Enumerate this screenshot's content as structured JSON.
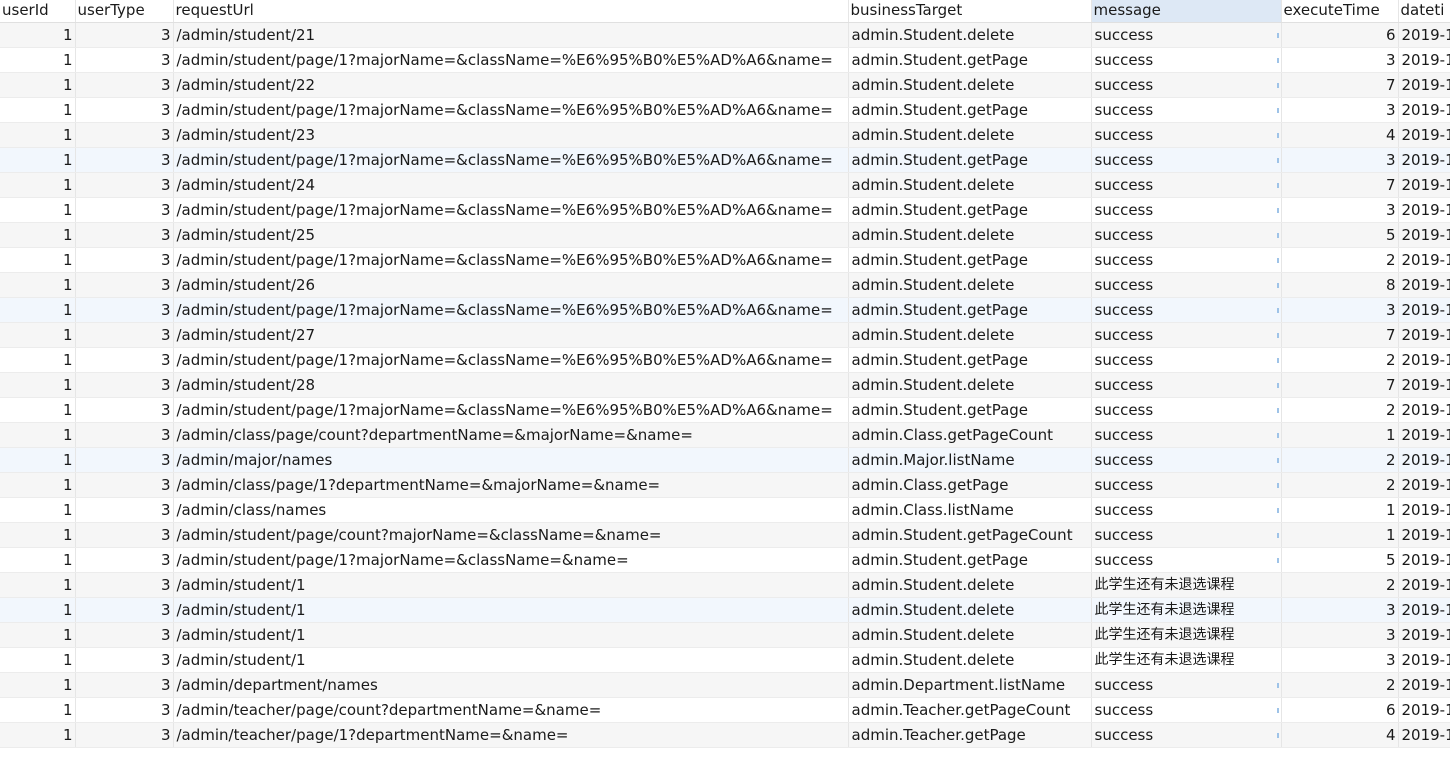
{
  "columns": [
    "userId",
    "userType",
    "requestUrl",
    "businessTarget",
    "message",
    "executeTime",
    "dateti"
  ],
  "sorted_column": "message",
  "rows": [
    {
      "userId": "1",
      "userType": "3",
      "requestUrl": "/admin/student/21",
      "businessTarget": "admin.Student.delete",
      "message": "success",
      "executeTime": "6",
      "datetime": "2019-1"
    },
    {
      "userId": "1",
      "userType": "3",
      "requestUrl": "/admin/student/page/1?majorName=&className=%E6%95%B0%E5%AD%A6&name=",
      "businessTarget": "admin.Student.getPage",
      "message": "success",
      "executeTime": "3",
      "datetime": "2019-1"
    },
    {
      "userId": "1",
      "userType": "3",
      "requestUrl": "/admin/student/22",
      "businessTarget": "admin.Student.delete",
      "message": "success",
      "executeTime": "7",
      "datetime": "2019-1"
    },
    {
      "userId": "1",
      "userType": "3",
      "requestUrl": "/admin/student/page/1?majorName=&className=%E6%95%B0%E5%AD%A6&name=",
      "businessTarget": "admin.Student.getPage",
      "message": "success",
      "executeTime": "3",
      "datetime": "2019-1"
    },
    {
      "userId": "1",
      "userType": "3",
      "requestUrl": "/admin/student/23",
      "businessTarget": "admin.Student.delete",
      "message": "success",
      "executeTime": "4",
      "datetime": "2019-1"
    },
    {
      "userId": "1",
      "userType": "3",
      "requestUrl": "/admin/student/page/1?majorName=&className=%E6%95%B0%E5%AD%A6&name=",
      "businessTarget": "admin.Student.getPage",
      "message": "success",
      "executeTime": "3",
      "datetime": "2019-1"
    },
    {
      "userId": "1",
      "userType": "3",
      "requestUrl": "/admin/student/24",
      "businessTarget": "admin.Student.delete",
      "message": "success",
      "executeTime": "7",
      "datetime": "2019-1"
    },
    {
      "userId": "1",
      "userType": "3",
      "requestUrl": "/admin/student/page/1?majorName=&className=%E6%95%B0%E5%AD%A6&name=",
      "businessTarget": "admin.Student.getPage",
      "message": "success",
      "executeTime": "3",
      "datetime": "2019-1"
    },
    {
      "userId": "1",
      "userType": "3",
      "requestUrl": "/admin/student/25",
      "businessTarget": "admin.Student.delete",
      "message": "success",
      "executeTime": "5",
      "datetime": "2019-1"
    },
    {
      "userId": "1",
      "userType": "3",
      "requestUrl": "/admin/student/page/1?majorName=&className=%E6%95%B0%E5%AD%A6&name=",
      "businessTarget": "admin.Student.getPage",
      "message": "success",
      "executeTime": "2",
      "datetime": "2019-1"
    },
    {
      "userId": "1",
      "userType": "3",
      "requestUrl": "/admin/student/26",
      "businessTarget": "admin.Student.delete",
      "message": "success",
      "executeTime": "8",
      "datetime": "2019-1"
    },
    {
      "userId": "1",
      "userType": "3",
      "requestUrl": "/admin/student/page/1?majorName=&className=%E6%95%B0%E5%AD%A6&name=",
      "businessTarget": "admin.Student.getPage",
      "message": "success",
      "executeTime": "3",
      "datetime": "2019-1"
    },
    {
      "userId": "1",
      "userType": "3",
      "requestUrl": "/admin/student/27",
      "businessTarget": "admin.Student.delete",
      "message": "success",
      "executeTime": "7",
      "datetime": "2019-1"
    },
    {
      "userId": "1",
      "userType": "3",
      "requestUrl": "/admin/student/page/1?majorName=&className=%E6%95%B0%E5%AD%A6&name=",
      "businessTarget": "admin.Student.getPage",
      "message": "success",
      "executeTime": "2",
      "datetime": "2019-1"
    },
    {
      "userId": "1",
      "userType": "3",
      "requestUrl": "/admin/student/28",
      "businessTarget": "admin.Student.delete",
      "message": "success",
      "executeTime": "7",
      "datetime": "2019-1"
    },
    {
      "userId": "1",
      "userType": "3",
      "requestUrl": "/admin/student/page/1?majorName=&className=%E6%95%B0%E5%AD%A6&name=",
      "businessTarget": "admin.Student.getPage",
      "message": "success",
      "executeTime": "2",
      "datetime": "2019-1"
    },
    {
      "userId": "1",
      "userType": "3",
      "requestUrl": "/admin/class/page/count?departmentName=&majorName=&name=",
      "businessTarget": "admin.Class.getPageCount",
      "message": "success",
      "executeTime": "1",
      "datetime": "2019-1"
    },
    {
      "userId": "1",
      "userType": "3",
      "requestUrl": "/admin/major/names",
      "businessTarget": "admin.Major.listName",
      "message": "success",
      "executeTime": "2",
      "datetime": "2019-1"
    },
    {
      "userId": "1",
      "userType": "3",
      "requestUrl": "/admin/class/page/1?departmentName=&majorName=&name=",
      "businessTarget": "admin.Class.getPage",
      "message": "success",
      "executeTime": "2",
      "datetime": "2019-1"
    },
    {
      "userId": "1",
      "userType": "3",
      "requestUrl": "/admin/class/names",
      "businessTarget": "admin.Class.listName",
      "message": "success",
      "executeTime": "1",
      "datetime": "2019-1"
    },
    {
      "userId": "1",
      "userType": "3",
      "requestUrl": "/admin/student/page/count?majorName=&className=&name=",
      "businessTarget": "admin.Student.getPageCount",
      "message": "success",
      "executeTime": "1",
      "datetime": "2019-1"
    },
    {
      "userId": "1",
      "userType": "3",
      "requestUrl": "/admin/student/page/1?majorName=&className=&name=",
      "businessTarget": "admin.Student.getPage",
      "message": "success",
      "executeTime": "5",
      "datetime": "2019-1"
    },
    {
      "userId": "1",
      "userType": "3",
      "requestUrl": "/admin/student/1",
      "businessTarget": "admin.Student.delete",
      "message": "此学生还有未退选课程",
      "executeTime": "2",
      "datetime": "2019-1"
    },
    {
      "userId": "1",
      "userType": "3",
      "requestUrl": "/admin/student/1",
      "businessTarget": "admin.Student.delete",
      "message": "此学生还有未退选课程",
      "executeTime": "3",
      "datetime": "2019-1"
    },
    {
      "userId": "1",
      "userType": "3",
      "requestUrl": "/admin/student/1",
      "businessTarget": "admin.Student.delete",
      "message": "此学生还有未退选课程",
      "executeTime": "3",
      "datetime": "2019-1"
    },
    {
      "userId": "1",
      "userType": "3",
      "requestUrl": "/admin/student/1",
      "businessTarget": "admin.Student.delete",
      "message": "此学生还有未退选课程",
      "executeTime": "3",
      "datetime": "2019-1"
    },
    {
      "userId": "1",
      "userType": "3",
      "requestUrl": "/admin/department/names",
      "businessTarget": "admin.Department.listName",
      "message": "success",
      "executeTime": "2",
      "datetime": "2019-1"
    },
    {
      "userId": "1",
      "userType": "3",
      "requestUrl": "/admin/teacher/page/count?departmentName=&name=",
      "businessTarget": "admin.Teacher.getPageCount",
      "message": "success",
      "executeTime": "6",
      "datetime": "2019-1"
    },
    {
      "userId": "1",
      "userType": "3",
      "requestUrl": "/admin/teacher/page/1?departmentName=&name=",
      "businessTarget": "admin.Teacher.getPage",
      "message": "success",
      "executeTime": "4",
      "datetime": "2019-1"
    }
  ]
}
